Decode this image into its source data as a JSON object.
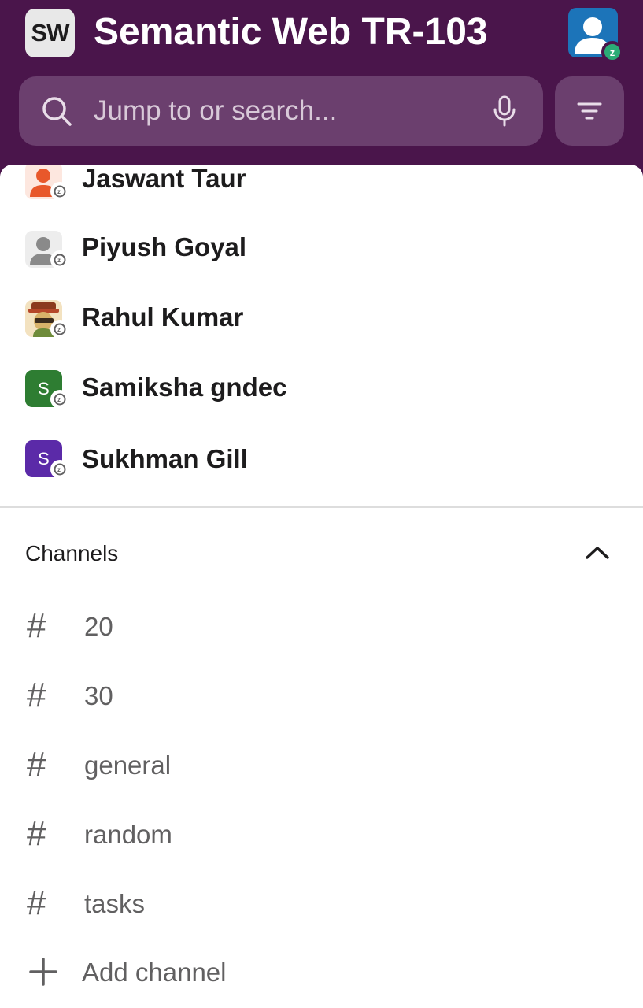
{
  "workspace": {
    "badge": "SW",
    "name": "Semantic Web TR-103"
  },
  "profile": {
    "dnd_badge": "z"
  },
  "search": {
    "placeholder": "Jump to or search..."
  },
  "direct_messages": [
    {
      "name": "Jaswant Taur",
      "avatar_color": "#e8582b",
      "avatar_type": "person"
    },
    {
      "name": "Piyush Goyal",
      "avatar_color": "#9e9e9e",
      "avatar_type": "person"
    },
    {
      "name": "Rahul Kumar",
      "avatar_color": "#c9a25a",
      "avatar_type": "photo"
    },
    {
      "name": "Samiksha gndec",
      "avatar_color": "#2e7d32",
      "avatar_type": "letter",
      "initial": "S"
    },
    {
      "name": "Sukhman Gill",
      "avatar_color": "#5b2aa8",
      "avatar_type": "letter",
      "initial": "S"
    }
  ],
  "channels_section": {
    "title": "Channels",
    "toggle_icon": "chevron-up-icon",
    "items": [
      {
        "hash": "#",
        "name": "20"
      },
      {
        "hash": "#",
        "name": "30"
      },
      {
        "hash": "#",
        "name": "general"
      },
      {
        "hash": "#",
        "name": "random"
      },
      {
        "hash": "#",
        "name": "tasks"
      }
    ],
    "add_label": "Add channel"
  },
  "colors": {
    "header_bg": "#4a154b",
    "search_bg": "#6b3f6e",
    "dnd_green": "#2bac76",
    "profile_blue": "#1c74b9"
  }
}
